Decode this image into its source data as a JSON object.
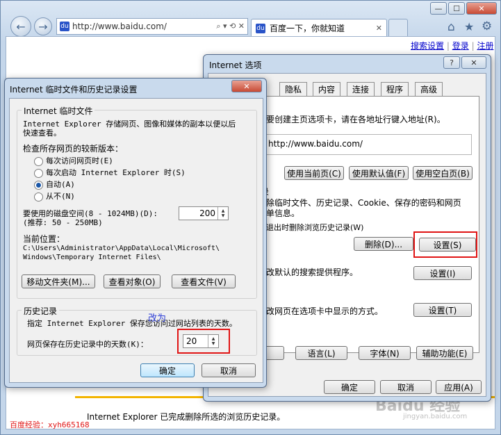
{
  "browser": {
    "address_url": "http://www.baidu.com/",
    "address_ctrl_glyphs": "⌕ ▾ ⟲ ✕",
    "tab1_title": "百度一下，你就知道",
    "tab_close": "✕",
    "win_min": "—",
    "win_max": "☐",
    "win_close": "✕",
    "back_glyph": "←",
    "forward_glyph": "→",
    "home_glyph": "⌂",
    "star_glyph": "★",
    "gear_glyph": "⚙",
    "fav_glyph": "du"
  },
  "page": {
    "links": [
      "搜索设置",
      "登录",
      "注册"
    ],
    "separators": [
      "|",
      "|"
    ],
    "status": "Internet Explorer 已完成删除所选的浏览历史记录。",
    "watermark_text": "百度经验：xyh665168",
    "watermark_logo": "Baidu 经验",
    "watermark_sub": "jingyan.baidu.com"
  },
  "options_dialog": {
    "title": "Internet 选项",
    "help": "?",
    "close": "✕",
    "tabs": [
      "隐私",
      "内容",
      "连接",
      "程序",
      "高级"
    ],
    "home_desc": "要创建主页选项卡，请在各地址行键入地址(R)。",
    "home_url": "http://www.baidu.com/",
    "btn_use_current": "使用当前页(C)",
    "btn_use_default": "使用默认值(F)",
    "btn_use_blank": "使用空白页(B)",
    "history_label": "录",
    "history_desc_1": "除临时文件、历史记录、Cookie、保存的密码和网页",
    "history_desc_2": "单信息。",
    "history_check": "退出时删除浏览历史记录(W)",
    "btn_delete": "删除(D)...",
    "btn_settings": "设置(S)",
    "search_desc": "改默认的搜索提供程序。",
    "btn_search_settings": "设置(I)",
    "tabs_desc": "改网页在选项卡中显示的方式。",
    "btn_tabs_settings": "设置(T)",
    "btn_language": "语言(L)",
    "btn_fonts": "字体(N)",
    "btn_accessibility": "辅助功能(E)",
    "btn_ok": "确定",
    "btn_cancel": "取消",
    "btn_apply": "应用(A)"
  },
  "temp_dialog": {
    "title": "Internet 临时文件和历史记录设置",
    "close": "✕",
    "group1_title": "Internet 临时文件",
    "desc_1": "Internet Explorer 存储网页、图像和媒体的副本以便以后",
    "desc_2": "快速查看。",
    "check_label": "检查所存网页的较新版本：",
    "radio_options": [
      "每次访问网页时(E)",
      "每次启动 Internet Explorer 时(S)",
      "自动(A)",
      "从不(N)"
    ],
    "selected_radio_index": 2,
    "disk_label_1": "要使用的磁盘空间(8 - 1024MB)(D):",
    "disk_label_2": "(推荐: 50 - 250MB)",
    "disk_value": "200",
    "location_label": "当前位置：",
    "location_1": "C:\\Users\\Administrator\\AppData\\Local\\Microsoft\\",
    "location_2": "Windows\\Temporary Internet Files\\",
    "btn_move": "移动文件夹(M)...",
    "btn_view_objects": "查看对象(O)",
    "btn_view_files": "查看文件(V)",
    "group2_title": "历史记录",
    "history_desc": "指定 Internet Explorer 保存您访问过网站列表的天数。",
    "annotation": "改为",
    "days_label": "网页保存在历史记录中的天数(K)：",
    "days_value": "20",
    "spin_up": "▲",
    "spin_down": "▼",
    "btn_ok": "确定",
    "btn_cancel": "取消"
  },
  "colors": {
    "highlight": "#e01414",
    "link": "#0000cc",
    "annotation": "#2f3fd6"
  }
}
